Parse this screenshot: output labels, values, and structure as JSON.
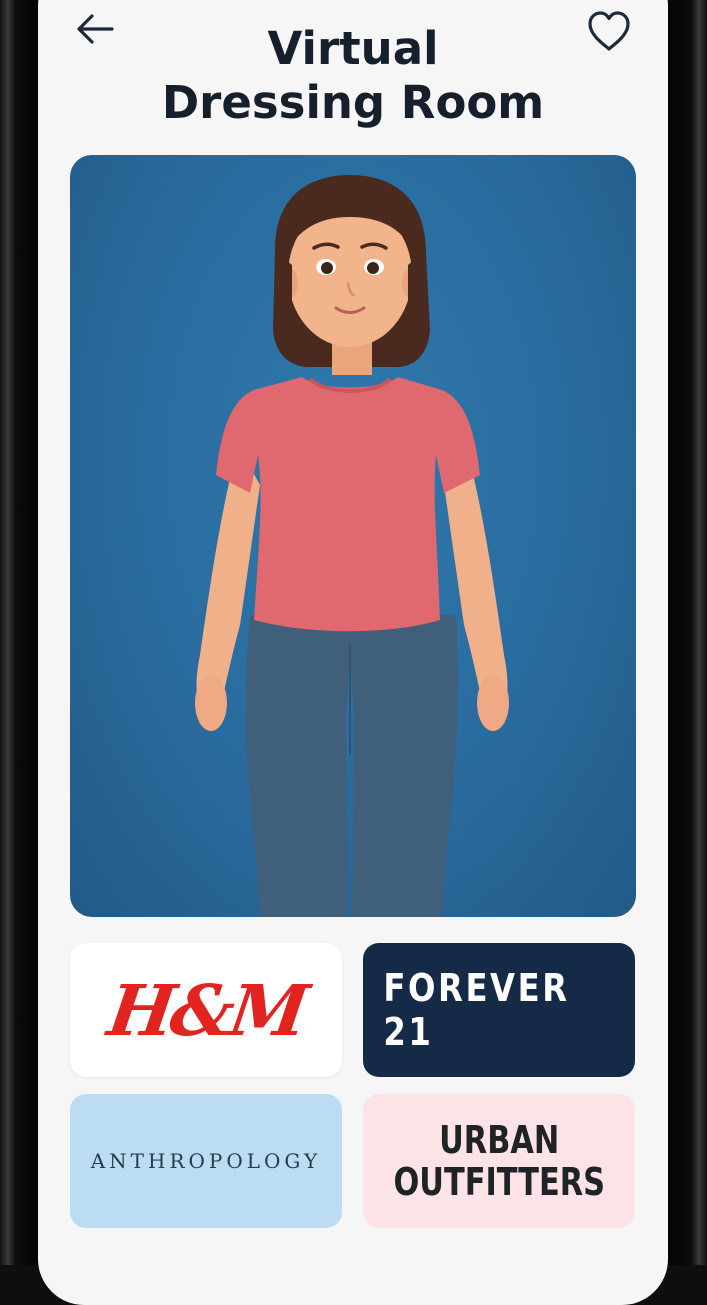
{
  "header": {
    "title_line1": "Virtual",
    "title_line2": "Dressing Room",
    "back_icon": "arrow-left-icon",
    "favorite_icon": "heart-outline-icon"
  },
  "avatar": {
    "top_color": "#e0686f",
    "jeans_color": "#3f5f7a",
    "background_color": "#2a6b9e"
  },
  "brands": [
    {
      "label": "H&M",
      "background": "#ffffff",
      "text_color": "#e1241f"
    },
    {
      "label": "FOREVER 21",
      "background": "#142a47",
      "text_color": "#ffffff"
    },
    {
      "label": "ANTHROPOLOGY",
      "background": "#bcdcf3",
      "text_color": "#2a3b4a"
    },
    {
      "label_line1": "URBAN",
      "label_line2": "OUTFITTERS",
      "background": "#fbe3e6",
      "text_color": "#1f2326"
    }
  ]
}
